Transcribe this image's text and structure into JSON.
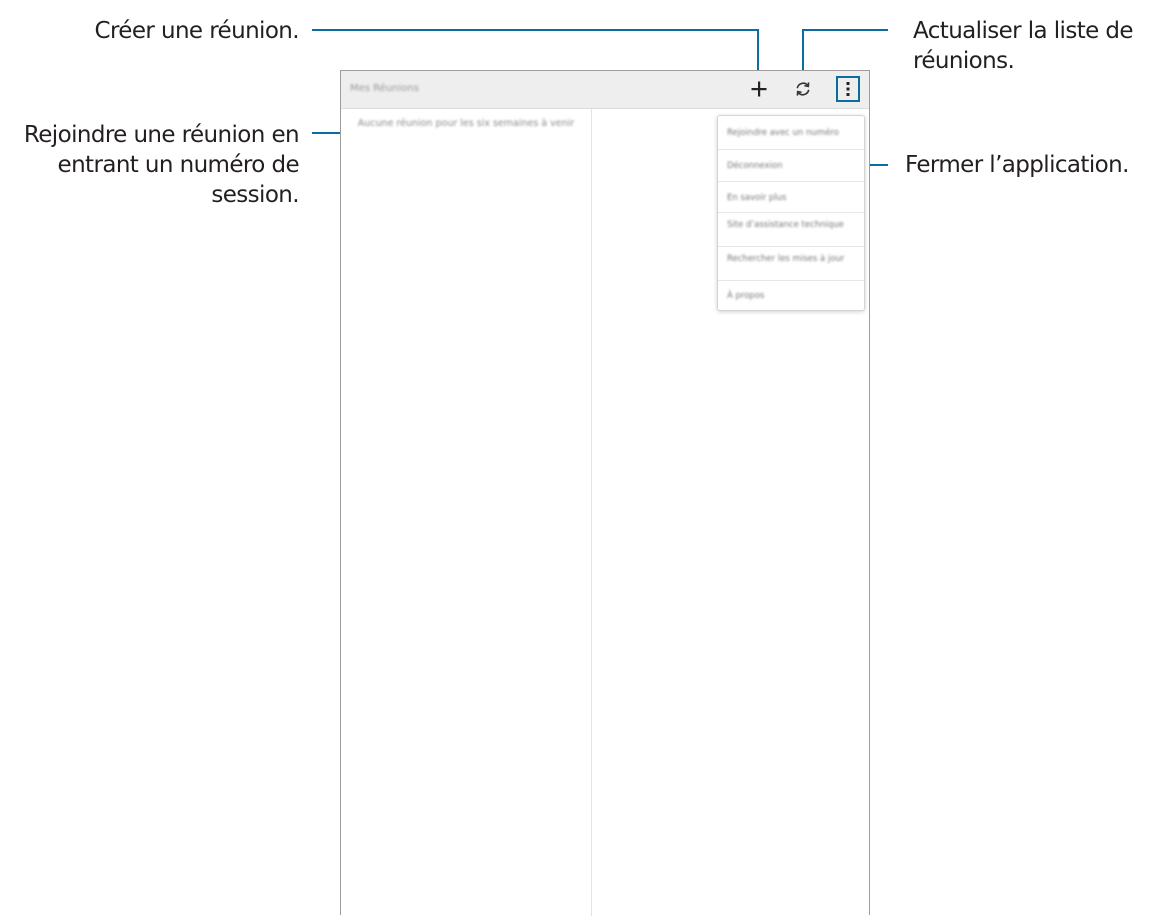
{
  "callouts": {
    "create": "Créer une réunion.",
    "join_line1": "Rejoindre une réunion en",
    "join_line2": "entrant un numéro de",
    "join_line3": "session.",
    "refresh_line1": "Actualiser la liste de",
    "refresh_line2": "réunions.",
    "close": "Fermer l’application."
  },
  "toolbar": {
    "title": "Mes Réunions",
    "add_icon": "plus-icon",
    "refresh_icon": "refresh-icon",
    "more_icon": "more-vertical-icon"
  },
  "left_pane": {
    "empty_message": "Aucune réunion pour les six semaines à venir"
  },
  "menu": {
    "items": [
      "Rejoindre avec un numéro",
      "Déconnexion",
      "En savoir plus",
      "Site d’assistance technique",
      "Rechercher les mises à jour",
      "À propos"
    ]
  },
  "colors": {
    "callout_line": "#0b6c9f",
    "toolbar_bg": "#eeeeee",
    "text": "#231f20"
  }
}
